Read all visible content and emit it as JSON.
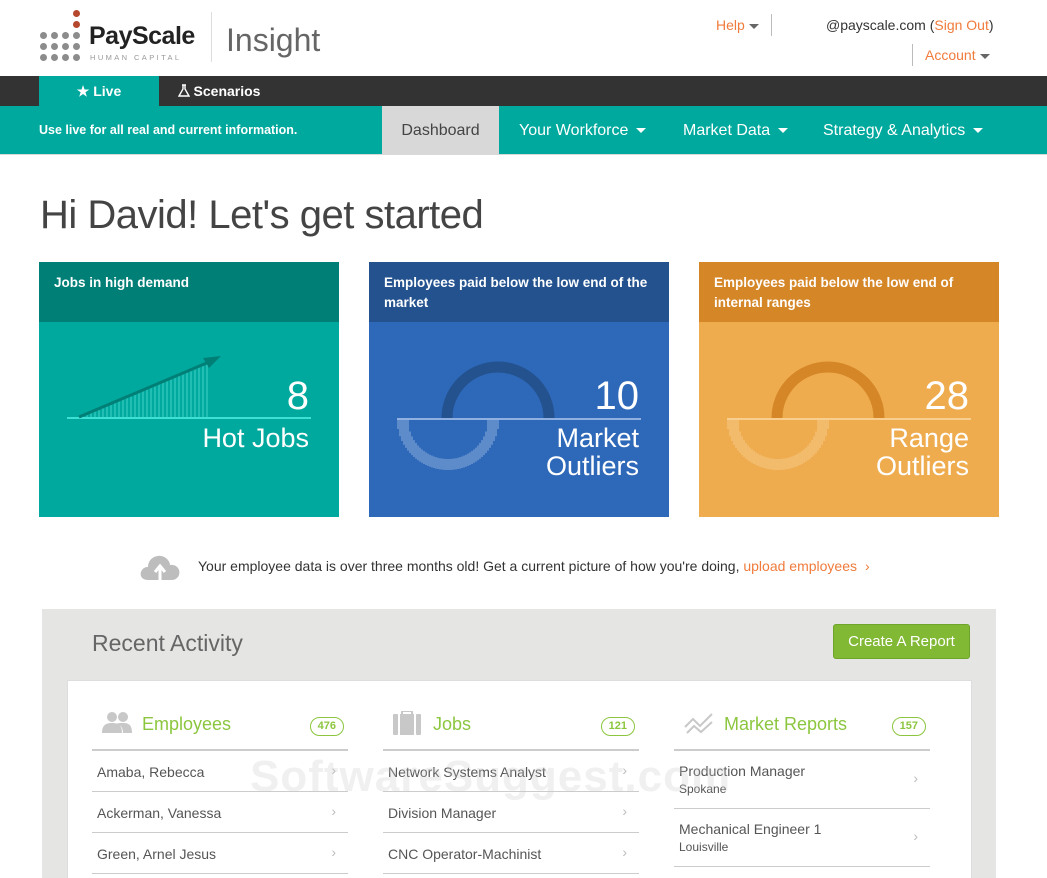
{
  "header": {
    "brand": "PayScale",
    "brand_sub": "HUMAN CAPITAL",
    "product": "Insight",
    "help": "Help",
    "user_email": "@payscale.com",
    "sign_out": "Sign Out",
    "account": "Account"
  },
  "mode_tabs": [
    {
      "label": "Live",
      "icon": "star-icon",
      "active": true
    },
    {
      "label": "Scenarios",
      "icon": "flask-icon",
      "active": false
    }
  ],
  "nav": {
    "info": "Use live for all real and current information.",
    "items": [
      {
        "label": "Dashboard",
        "active": true
      },
      {
        "label": "Your Workforce",
        "dropdown": true
      },
      {
        "label": "Market Data",
        "dropdown": true
      },
      {
        "label": "Strategy & Analytics",
        "dropdown": true
      }
    ]
  },
  "greeting": "Hi David! Let's get started",
  "cards": [
    {
      "title": "Jobs in high demand",
      "number": "8",
      "label": "Hot Jobs",
      "color": "#00a99d",
      "head_color": "#007f77"
    },
    {
      "title": "Employees paid below the low end of the market",
      "number": "10",
      "label_line1": "Market",
      "label_line2": "Outliers",
      "color": "#2e68b8",
      "head_color": "#23528f"
    },
    {
      "title": "Employees paid below the low end of internal ranges",
      "number": "28",
      "label_line1": "Range",
      "label_line2": "Outliers",
      "color": "#efac4e",
      "head_color": "#d58627"
    }
  ],
  "notice": {
    "text": "Your employee data is over three months old! Get a current picture of how you're doing, ",
    "link": "upload employees",
    "chevron": "›"
  },
  "recent": {
    "title": "Recent Activity",
    "create_button": "Create A Report",
    "columns": [
      {
        "title": "Employees",
        "count": "476",
        "icon": "people-icon",
        "rows": [
          {
            "text": "Amaba, Rebecca"
          },
          {
            "text": "Ackerman, Vanessa"
          },
          {
            "text": "Green, Arnel Jesus"
          }
        ]
      },
      {
        "title": "Jobs",
        "count": "121",
        "icon": "briefcase-icon",
        "rows": [
          {
            "text": "Network Systems Analyst"
          },
          {
            "text": "Division Manager"
          },
          {
            "text": "CNC Operator-Machinist"
          }
        ]
      },
      {
        "title": "Market Reports",
        "count": "157",
        "icon": "trend-chart-icon",
        "rows": [
          {
            "title": "Production Manager",
            "sub": "Spokane"
          },
          {
            "title": "Mechanical Engineer 1",
            "sub": "Louisville"
          }
        ]
      }
    ]
  },
  "chevron": "›",
  "watermark": "SoftwareSuggest.com",
  "colors": {
    "teal": "#00a99d",
    "orange_link": "#f07b3c",
    "green": "#8cc63f",
    "button_green": "#81b834"
  }
}
